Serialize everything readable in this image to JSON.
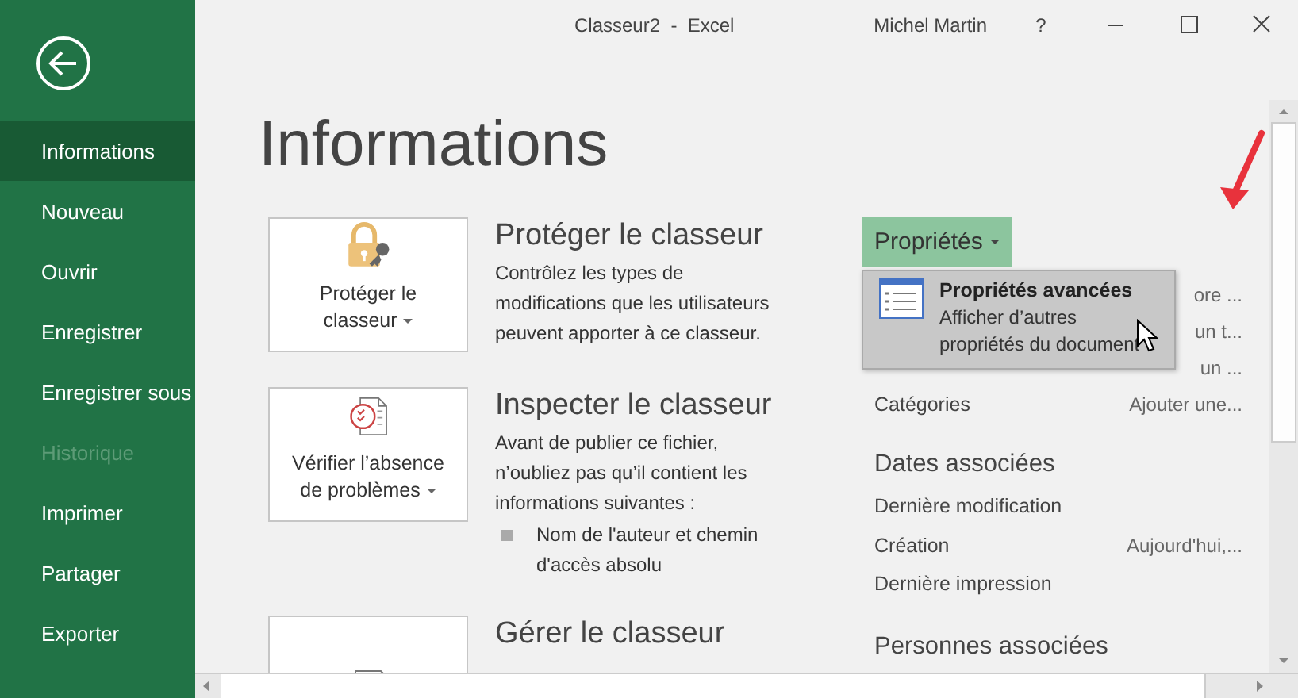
{
  "window": {
    "title": "Classeur2  -  Excel",
    "user": "Michel Martin",
    "help": "?"
  },
  "sidebar": {
    "items": [
      {
        "label": "Informations",
        "selected": true,
        "disabled": false
      },
      {
        "label": "Nouveau",
        "selected": false,
        "disabled": false
      },
      {
        "label": "Ouvrir",
        "selected": false,
        "disabled": false
      },
      {
        "label": "Enregistrer",
        "selected": false,
        "disabled": false
      },
      {
        "label": "Enregistrer sous",
        "selected": false,
        "disabled": false
      },
      {
        "label": "Historique",
        "selected": false,
        "disabled": true
      },
      {
        "label": "Imprimer",
        "selected": false,
        "disabled": false
      },
      {
        "label": "Partager",
        "selected": false,
        "disabled": false
      },
      {
        "label": "Exporter",
        "selected": false,
        "disabled": false
      }
    ]
  },
  "page_title": "Informations",
  "sections": [
    {
      "kind": "lock",
      "button_label": "Protéger le classeur",
      "heading": "Protéger le classeur",
      "description": "Contrôlez les types de modifications que les utilisateurs peuvent apporter à ce classeur."
    },
    {
      "kind": "inspect",
      "button_label": "Vérifier l’absence de problèmes",
      "heading": "Inspecter le classeur",
      "description": "Avant de publier ce fichier, n’oubliez pas qu’il contient les informations suivantes :",
      "bullets": [
        "Nom de l'auteur et chemin d'accès absolu"
      ]
    },
    {
      "kind": "manage",
      "heading": "Gérer le classeur"
    }
  ],
  "properties": {
    "button": "Propriétés",
    "menu": {
      "items": [
        {
          "title": "Propriétés avancées",
          "description": "Afficher d’autres propriétés du document"
        }
      ]
    },
    "rows": [
      {
        "value": "ore ..."
      },
      {
        "value": "un t..."
      },
      {
        "value": "un ..."
      },
      {
        "label": "Catégories",
        "value": "Ajouter une..."
      }
    ],
    "groups": [
      {
        "heading": "Dates associées",
        "rows": [
          {
            "label": "Dernière modification"
          },
          {
            "label": "Création",
            "value": "Aujourd'hui,..."
          },
          {
            "label": "Dernière impression"
          }
        ]
      },
      {
        "heading": "Personnes associées"
      }
    ]
  }
}
